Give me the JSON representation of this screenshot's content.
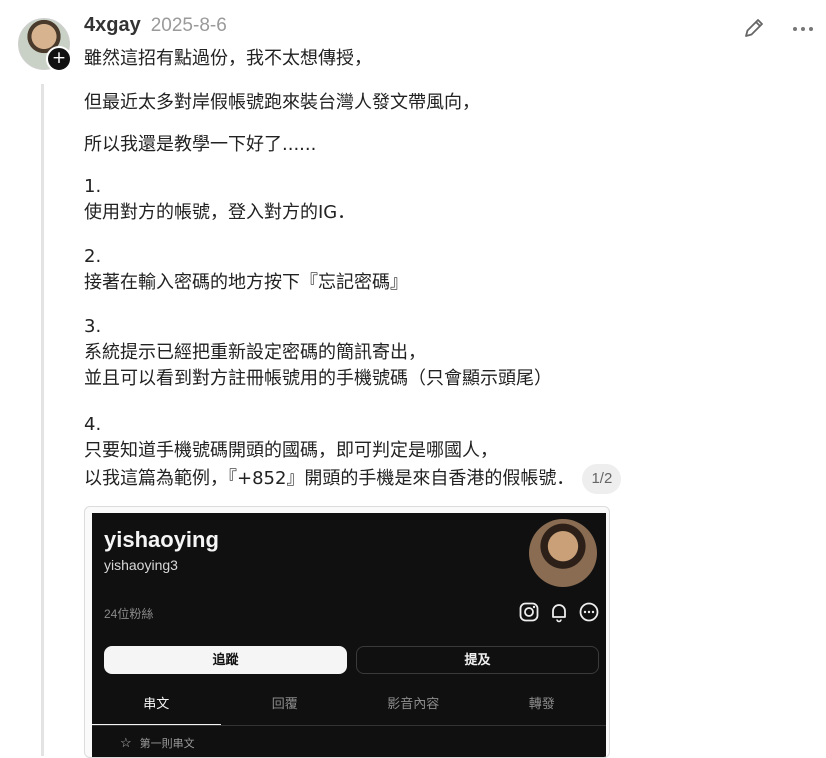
{
  "post": {
    "username": "4xgay",
    "date": "2025-8-6",
    "lines": [
      "雖然這招有點過份，我不太想傳授，",
      "但最近太多對岸假帳號跑來裝台灣人發文帶風向，",
      "所以我還是教學一下好了......",
      "1.",
      "使用對方的帳號，登入對方的IG．",
      "2.",
      "接著在輸入密碼的地方按下『忘記密碼』",
      "3.",
      "系統提示已經把重新設定密碼的簡訊寄出，",
      "並且可以看到對方註冊帳號用的手機號碼（只會顯示頭尾）",
      "4.",
      "只要知道手機號碼開頭的國碼，即可判定是哪國人，",
      "以我這篇為範例，『+852』開頭的手機是來自香港的假帳號．"
    ],
    "page_badge": "1/2"
  },
  "embed": {
    "display_name": "yishaoying",
    "handle": "yishaoying3",
    "followers": "24位粉絲",
    "follow_button": "追蹤",
    "mention_button": "提及",
    "tabs": [
      "串文",
      "回覆",
      "影音內容",
      "轉發"
    ],
    "first_post_label": "第一則串文"
  },
  "icons": {
    "edit": "pencil-icon",
    "more": "more-horizontal-icon",
    "follow_plus": "plus-icon",
    "instagram": "instagram-icon",
    "bell": "bell-icon",
    "ellipsis": "ellipsis-circle-icon",
    "star": "star-icon"
  },
  "colors": {
    "text": "#222222",
    "muted": "#9a9a9a",
    "embed_bg": "#101010"
  }
}
